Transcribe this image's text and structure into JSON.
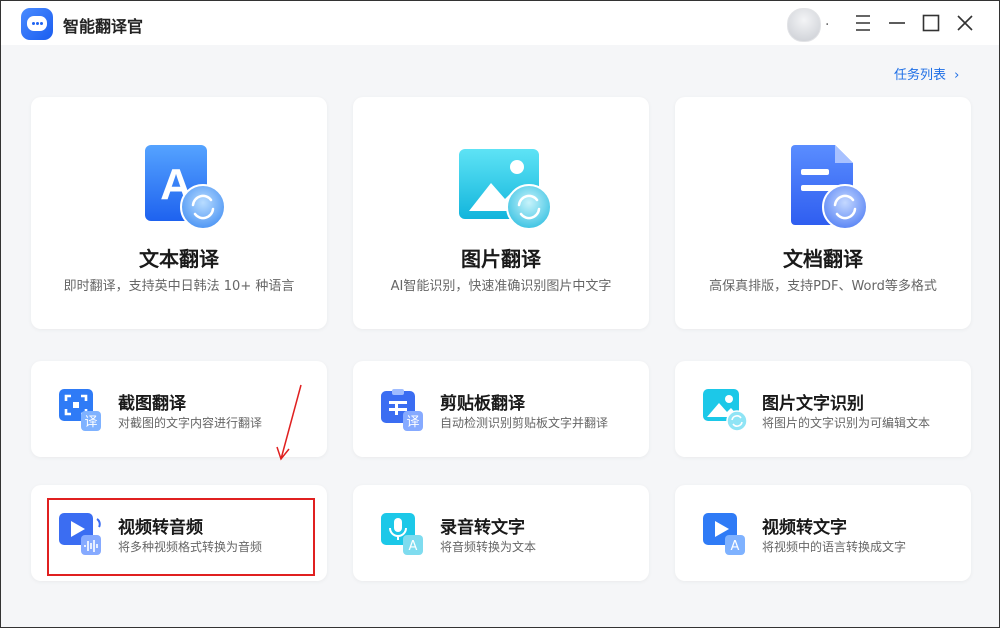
{
  "app": {
    "title": "智能翻译官",
    "avatar_text": "."
  },
  "header": {
    "task_list_label": "任务列表",
    "task_list_chevron": "›"
  },
  "big_cards": [
    {
      "title": "文本翻译",
      "desc": "即时翻译，支持英中日韩法 10+ 种语言",
      "icon": "text-translate-icon",
      "glyph": "A"
    },
    {
      "title": "图片翻译",
      "desc": "AI智能识别，快速准确识别图片中文字",
      "icon": "image-translate-icon"
    },
    {
      "title": "文档翻译",
      "desc": "高保真排版，支持PDF、Word等多格式",
      "icon": "document-translate-icon"
    }
  ],
  "small_cards": [
    {
      "title": "截图翻译",
      "desc": "对截图的文字内容进行翻译",
      "icon": "screenshot-translate-icon",
      "badge": "译"
    },
    {
      "title": "剪贴板翻译",
      "desc": "自动检测识别剪贴板文字并翻译",
      "icon": "clipboard-translate-icon",
      "badge": "译"
    },
    {
      "title": "图片文字识别",
      "desc": "将图片的文字识别为可编辑文本",
      "icon": "image-ocr-icon"
    },
    {
      "title": "视频转音频",
      "desc": "将多种视频格式转换为音频",
      "icon": "video-to-audio-icon"
    },
    {
      "title": "录音转文字",
      "desc": "将音频转换为文本",
      "icon": "audio-to-text-icon",
      "badge": "A"
    },
    {
      "title": "视频转文字",
      "desc": "将视频中的语言转换成文字",
      "icon": "video-to-text-icon",
      "badge": "A"
    }
  ],
  "colors": {
    "accent": "#1e6fe6",
    "highlight": "#e02020",
    "icon_blue": "#2f7bf6",
    "icon_cyan": "#1cc8e8"
  }
}
